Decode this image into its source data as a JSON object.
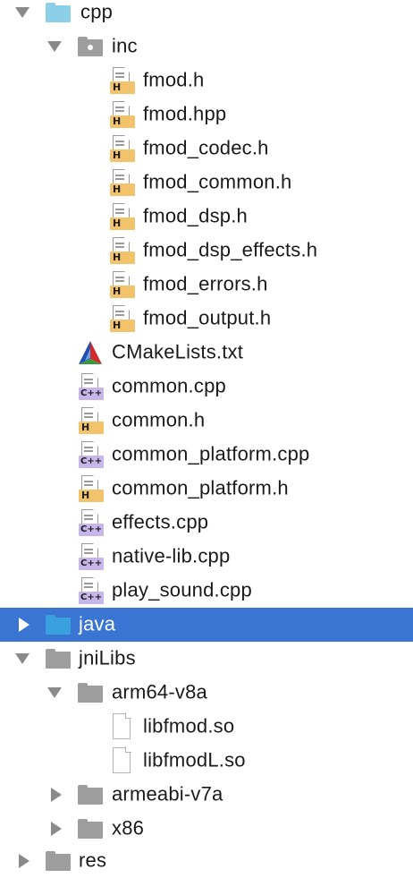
{
  "tree": {
    "cpp": "cpp",
    "inc": "inc",
    "inc_files": [
      "fmod.h",
      "fmod.hpp",
      "fmod_codec.h",
      "fmod_common.h",
      "fmod_dsp.h",
      "fmod_dsp_effects.h",
      "fmod_errors.h",
      "fmod_output.h"
    ],
    "cpp_files": {
      "cmake": "CMakeLists.txt",
      "common_cpp": "common.cpp",
      "common_h": "common.h",
      "common_platform_cpp": "common_platform.cpp",
      "common_platform_h": "common_platform.h",
      "effects_cpp": "effects.cpp",
      "native_lib_cpp": "native-lib.cpp",
      "play_sound_cpp": "play_sound.cpp"
    },
    "java": "java",
    "jniLibs": "jniLibs",
    "arm64": "arm64-v8a",
    "arm64_files": [
      "libfmod.so",
      "libfmodL.so"
    ],
    "armeabi": "armeabi-v7a",
    "x86": "x86",
    "res": "res"
  },
  "icons": {
    "source_folder": "cyan-folder-icon",
    "java_folder": "blue-folder-icon",
    "package_folder": "gray-folder-icon",
    "header_file": "h-file-icon",
    "cpp_file": "cpp-file-icon",
    "cmake_file": "cmake-icon",
    "so_file": "plain-file-icon"
  },
  "colors": {
    "selection": "#3a75d4",
    "header_badge": "#f2c36b",
    "cpp_badge": "#c6b6ea",
    "cyan_folder": "#8ccfe8",
    "blue_folder": "#39a2de"
  }
}
